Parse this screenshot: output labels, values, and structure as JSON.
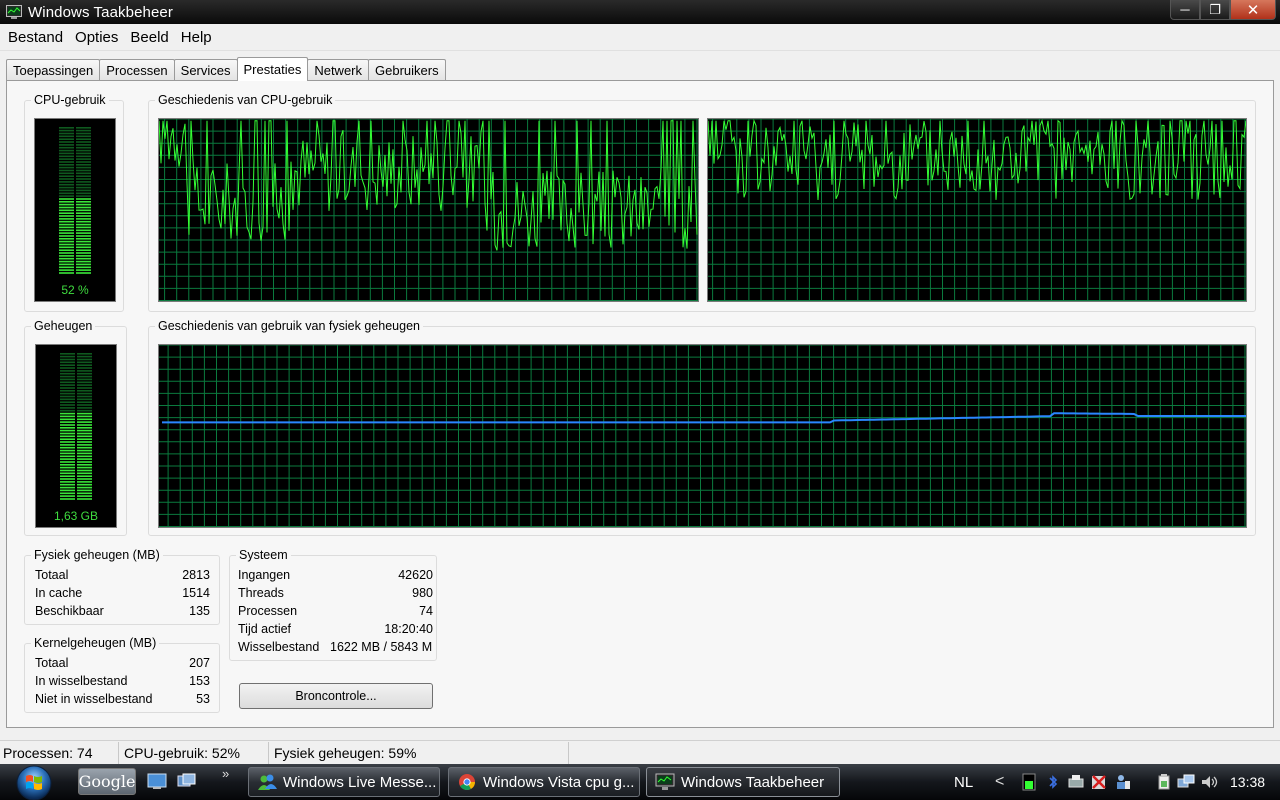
{
  "window": {
    "title": "Windows Taakbeheer"
  },
  "menu": [
    "Bestand",
    "Opties",
    "Beeld",
    "Help"
  ],
  "tabs": [
    {
      "label": "Toepassingen",
      "active": false
    },
    {
      "label": "Processen",
      "active": false
    },
    {
      "label": "Services",
      "active": false
    },
    {
      "label": "Prestaties",
      "active": true
    },
    {
      "label": "Netwerk",
      "active": false
    },
    {
      "label": "Gebruikers",
      "active": false
    }
  ],
  "cpu": {
    "label": "CPU-gebruik",
    "value_text": "52 %",
    "level": 0.52,
    "history_label": "Geschiedenis van CPU-gebruik"
  },
  "memory": {
    "label": "Geheugen",
    "value_text": "1,63 GB",
    "level": 0.59,
    "history_label": "Geschiedenis van gebruik van fysiek geheugen"
  },
  "colors": {
    "meter_green": "#39e639",
    "grid": "#0b7a3e",
    "cpu_line": "#34ff34",
    "mem_line": "#2a86ff"
  },
  "physical": {
    "label": "Fysiek geheugen (MB)",
    "rows": [
      {
        "k": "Totaal",
        "v": "2813"
      },
      {
        "k": "In cache",
        "v": "1514"
      },
      {
        "k": "Beschikbaar",
        "v": "135"
      }
    ]
  },
  "kernel": {
    "label": "Kernelgeheugen (MB)",
    "rows": [
      {
        "k": "Totaal",
        "v": "207"
      },
      {
        "k": "In wisselbestand",
        "v": "153"
      },
      {
        "k": "Niet in wisselbestand",
        "v": "53"
      }
    ]
  },
  "system": {
    "label": "Systeem",
    "rows": [
      {
        "k": "Ingangen",
        "v": "42620"
      },
      {
        "k": "Threads",
        "v": "980"
      },
      {
        "k": "Processen",
        "v": "74"
      },
      {
        "k": "Tijd actief",
        "v": "18:20:40"
      },
      {
        "k": "Wisselbestand",
        "v": "1622 MB / 5843 M"
      }
    ]
  },
  "resmon_button": "Broncontrole...",
  "status": {
    "processes": "Processen: 74",
    "cpu": "CPU-gebruik: 52%",
    "memory": "Fysiek geheugen: 59%"
  },
  "taskbar": {
    "search": "Google",
    "more": "»",
    "items": [
      {
        "label": "Windows Live Messe...",
        "icon": "messenger-icon",
        "active": false
      },
      {
        "label": "Windows Vista cpu g...",
        "icon": "chrome-icon",
        "active": false
      },
      {
        "label": "Windows Taakbeheer",
        "icon": "taskmanager-icon",
        "active": true
      }
    ],
    "language": "NL",
    "tray_arrow": "<",
    "clock": "13:38"
  }
}
